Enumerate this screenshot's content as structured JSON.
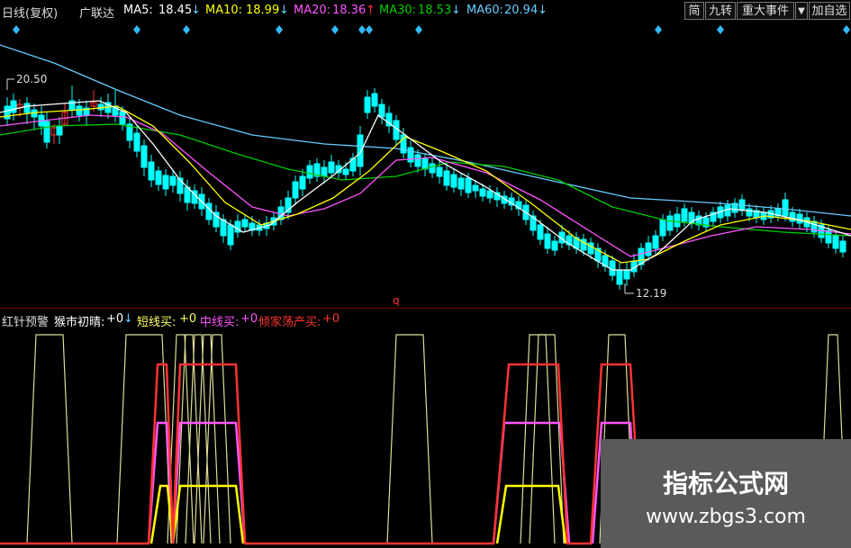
{
  "header": {
    "period_label": "日线(复权)",
    "stock_name": "广联达",
    "ma5": {
      "label": "MA5:",
      "value": "18.45",
      "arrow": "↓",
      "color": "#ffffff"
    },
    "ma10": {
      "label": "MA10:",
      "value": "18.99",
      "arrow": "↓",
      "color": "#ffff00"
    },
    "ma20": {
      "label": "MA20:",
      "value": "18.36",
      "arrow": "↑",
      "color": "#ff55ff"
    },
    "ma30": {
      "label": "MA30:",
      "value": "18.53",
      "arrow": "↓",
      "color": "#00cc00"
    },
    "ma60": {
      "label": "MA60:",
      "value": "20.94",
      "arrow": "↓",
      "color": "#66ccff"
    }
  },
  "toolbar": {
    "simplified_label": "简",
    "jiuzhuan_label": "九转",
    "events_label": "重大事件",
    "dropdown_label": "▼",
    "add_watch_label": "加自选"
  },
  "price_chart": {
    "high_label": "20.50",
    "low_label": "12.19",
    "marker_q": "q"
  },
  "indicator": {
    "name": "红针预警",
    "l1": {
      "label": "猴市初晴:",
      "value": "+0",
      "arrow": "↓",
      "color": "#ffffff"
    },
    "l2": {
      "label": "短线买:",
      "value": "+0",
      "color": "#ffff66"
    },
    "l3": {
      "label": "中线买:",
      "value": "+0",
      "color": "#ff55ff"
    },
    "l4": {
      "label": "倾家荡产买:",
      "value": "+0",
      "color": "#ff3333"
    }
  },
  "watermark": {
    "title": "指标公式网",
    "url": "www.zbgs3.com"
  },
  "colors": {
    "up": "#ff3333",
    "down": "#00ffff",
    "ma_white": "#ffffff",
    "ma_yellow": "#ffff00",
    "ma_magenta": "#ff55ff",
    "ma_green": "#00cc00",
    "ma_blue": "#66ccff"
  }
}
